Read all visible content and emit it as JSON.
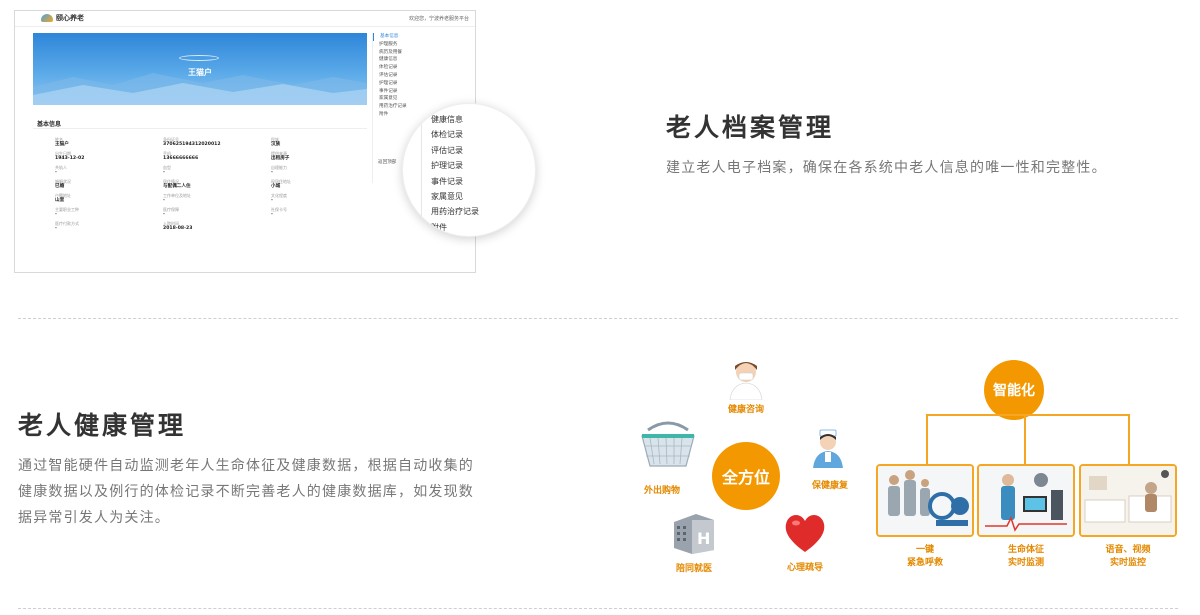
{
  "mockup": {
    "logo_text": "颐心养老",
    "welcome": "欢迎您，宁波养老服务平台",
    "banner_name": "王猫户",
    "basic_info_title": "基本信息",
    "fields": [
      {
        "k": "姓名",
        "v": "王猫户"
      },
      {
        "k": "身份证号",
        "v": "370625194312020012"
      },
      {
        "k": "民族",
        "v": "汉族"
      },
      {
        "k": "出生日期",
        "v": "1943-12-02"
      },
      {
        "k": "手机",
        "v": "13666666666"
      },
      {
        "k": "提供来源",
        "v": "出租房子"
      },
      {
        "k": "共轨人",
        "v": "-"
      },
      {
        "k": "血型",
        "v": "-"
      },
      {
        "k": "自理能力",
        "v": "-"
      },
      {
        "k": "婚姻状况",
        "v": "已婚"
      },
      {
        "k": "居住情况",
        "v": "与配偶二人住"
      },
      {
        "k": "现居住地址",
        "v": "小城"
      },
      {
        "k": "户籍地址",
        "v": "山里"
      },
      {
        "k": "工作单位及地址",
        "v": "-"
      },
      {
        "k": "文化程度",
        "v": "-"
      },
      {
        "k": "主要职业工种",
        "v": "-"
      },
      {
        "k": "医疗保障",
        "v": "-"
      },
      {
        "k": "社保卡号",
        "v": "-"
      },
      {
        "k": "医疗付款方式",
        "v": "-"
      },
      {
        "k": "入院时间",
        "v": "2018-08-23"
      },
      {
        "k": "",
        "v": ""
      }
    ],
    "side_items": [
      "基本信息",
      "护理服务",
      "病历及用餐",
      "健康信息",
      "体检记录",
      "评估记录",
      "护理记录",
      "事件记录",
      "家属意见",
      "用药治疗记录",
      "附件"
    ],
    "side_bottom": "返回顶部",
    "magnifier_items": [
      "健康信息",
      "体检记录",
      "评估记录",
      "护理记录",
      "事件记录",
      "家属意见",
      "用药治疗记录",
      "附件"
    ]
  },
  "section1": {
    "title": "老人档案管理",
    "desc": "建立老人电子档案，确保在各系统中老人信息的唯一性和完整性。"
  },
  "section2": {
    "title": "老人健康管理",
    "desc_lines": [
      "通过智能硬件自动监测老年人生命体征及健康数据，根据自动收集的",
      "健康数据以及例行的体检记录不断完善老人的健康数据库，如发现数",
      "据异常引发人为关注。"
    ]
  },
  "omni": {
    "center": "全方位",
    "items": [
      "健康咨询",
      "保健康复",
      "心理疏导",
      "陪同就医",
      "外出购物"
    ]
  },
  "smart": {
    "center": "智能化",
    "panels": [
      {
        "line1": "一键",
        "line2": "紧急呼救"
      },
      {
        "line1": "生命体征",
        "line2": "实时监测"
      },
      {
        "line1": "语音、视频",
        "line2": "实时监控"
      }
    ]
  },
  "colors": {
    "accent": "#f39800",
    "banner": "#2e86d9",
    "text": "#333333",
    "muted": "#777777"
  },
  "icons": [
    "doctor-icon",
    "nurse-icon",
    "heart-icon",
    "hospital-icon",
    "shopping-basket-icon",
    "logo-icon",
    "alarm-scene-icon",
    "vital-monitor-icon",
    "video-monitor-icon"
  ]
}
